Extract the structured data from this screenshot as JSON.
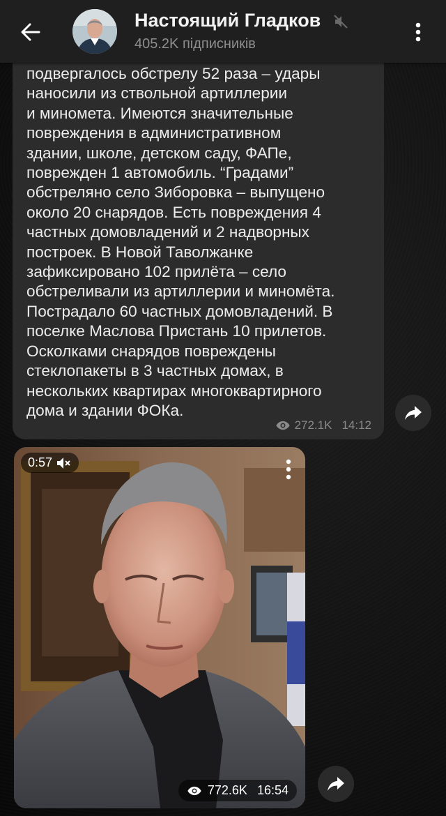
{
  "header": {
    "title": "Настоящий Гладков",
    "subtitle": "405.2K підписників",
    "back_icon": "arrow-left-icon",
    "mute_icon": "muted-speaker-icon",
    "menu_icon": "more-vertical-icon"
  },
  "message": {
    "text": "подвергалось обстрелу 52 раза – удары\nнаносили из ствольной артиллерии\nи миномета. Имеются значительные\nповреждения в административном\nздании, школе, детском саду, ФАПе,\nповрежден 1 автомобиль. “Градами”\nобстреляно село Зиборовка – выпущено\nоколо 20 снарядов. Есть повреждения 4\nчастных домовладений и 2 надворных\nпостроек. В Новой Таволжанке\nзафиксировано 102 прилёта – село\nобстреливали из артиллерии и миномёта.\nПострадало 60 частных домовладений. В\nпоселке Маслова Пристань 10 прилетов.\nОсколками снарядов повреждены\nстеклопакеты в 3 частных домах, в\nнескольких квартирах многоквартирного\nдома и здании ФОКа.",
    "views": "272.1K",
    "time": "14:12"
  },
  "video_message": {
    "duration": "0:57",
    "views": "772.6K",
    "time": "16:54"
  },
  "colors": {
    "header_bg": "#1f1f1f",
    "bubble_bg": "#2c2c2c",
    "text": "#ececec",
    "meta": "#8a8a8a"
  }
}
